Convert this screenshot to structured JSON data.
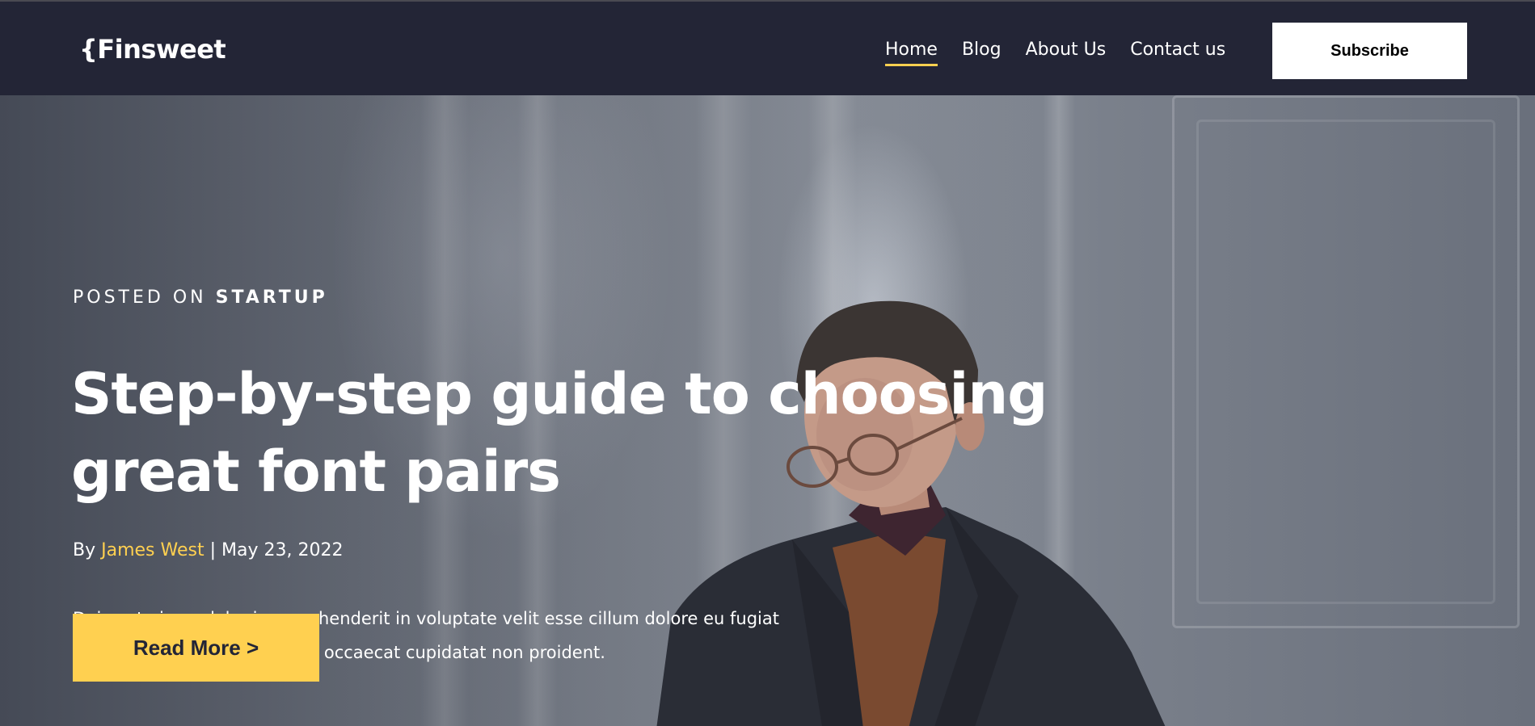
{
  "header": {
    "logo": "{Finsweet",
    "nav": [
      {
        "label": "Home",
        "active": true
      },
      {
        "label": "Blog",
        "active": false
      },
      {
        "label": "About Us",
        "active": false
      },
      {
        "label": "Contact us",
        "active": false
      }
    ],
    "subscribe_label": "Subscribe"
  },
  "hero": {
    "posted_on_prefix": "POSTED ON",
    "category": "STARTUP",
    "title": "Step-by-step guide to choosing great font pairs",
    "byline_prefix": "By",
    "author": "James West",
    "separator": "|",
    "date": "May 23, 2022",
    "excerpt": "Duis aute irure dolor in reprehenderit in voluptate velit esse cillum dolore eu fugiat nulla pariatur. Excepteur sint occaecat cupidatat non proident.",
    "read_more_label": "Read More >"
  },
  "colors": {
    "header_bg": "#232536",
    "accent": "#FFD050",
    "text": "#ffffff"
  }
}
